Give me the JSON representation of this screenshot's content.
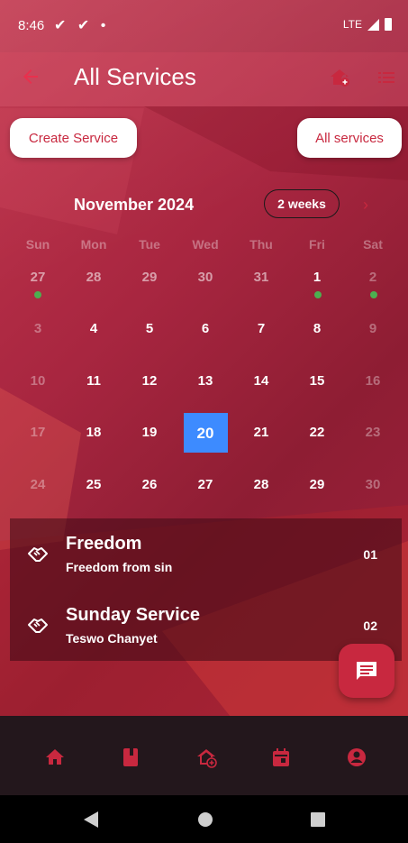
{
  "status": {
    "time": "8:46",
    "left_icons": "✔ ✔ •",
    "network": "LTE"
  },
  "appbar": {
    "title": "All Services"
  },
  "actions": {
    "create_label": "Create Service",
    "all_label": "All services"
  },
  "calendar": {
    "month": "November 2024",
    "format_label": "2 weeks",
    "weekdays": [
      "Sun",
      "Mon",
      "Tue",
      "Wed",
      "Thu",
      "Fri",
      "Sat"
    ],
    "selected_day": "20",
    "weeks": [
      [
        "27",
        "28",
        "29",
        "30",
        "31",
        "1",
        "2"
      ],
      [
        "3",
        "4",
        "5",
        "6",
        "7",
        "8",
        "9"
      ],
      [
        "10",
        "11",
        "12",
        "13",
        "14",
        "15",
        "16"
      ],
      [
        "17",
        "18",
        "19",
        "20",
        "21",
        "22",
        "23"
      ],
      [
        "24",
        "25",
        "26",
        "27",
        "28",
        "29",
        "30"
      ]
    ],
    "event_days": [
      "27 Oct",
      "1 Nov",
      "2 Nov"
    ]
  },
  "events": [
    {
      "title": "Freedom",
      "subtitle": "Freedom from sin",
      "number": "01"
    },
    {
      "title": "Sunday Service",
      "subtitle": "Teswo Chanyet",
      "number": "02"
    }
  ],
  "colors": {
    "accent": "#c8283f",
    "selected_day": "#3d8bff",
    "event_dot": "#4caf50",
    "bottom_nav": "#23171c"
  },
  "icons": {
    "nav": [
      "home-icon",
      "book-icon",
      "add-location-icon",
      "calendar-icon",
      "account-icon"
    ],
    "appbar": [
      "add-location-icon",
      "list-icon"
    ],
    "fab": "chat-icon",
    "event": "handshake-icon"
  }
}
